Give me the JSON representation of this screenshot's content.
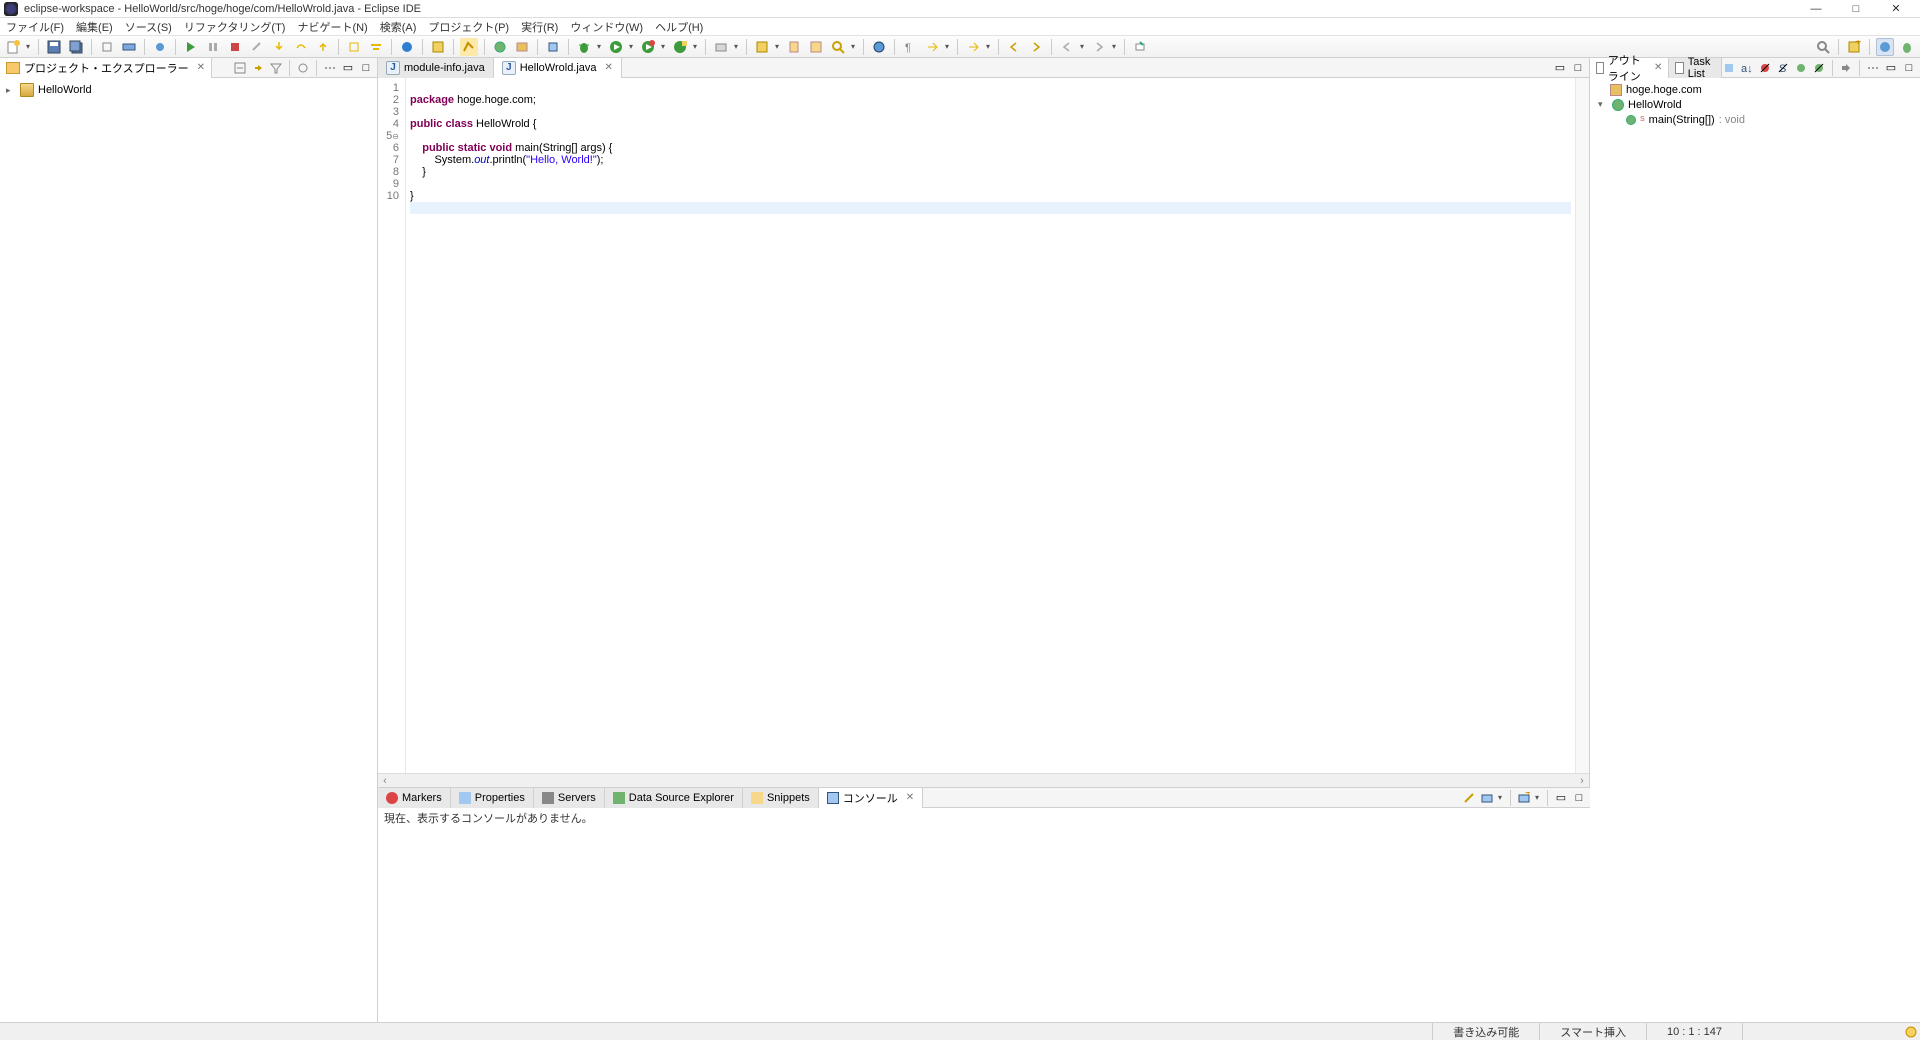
{
  "window": {
    "title": "eclipse-workspace - HelloWorld/src/hoge/hoge/com/HelloWrold.java - Eclipse IDE"
  },
  "menu": {
    "file": "ファイル(F)",
    "edit": "編集(E)",
    "source": "ソース(S)",
    "refactor": "リファクタリング(T)",
    "navigate": "ナビゲート(N)",
    "search": "検索(A)",
    "project": "プロジェクト(P)",
    "run": "実行(R)",
    "window": "ウィンドウ(W)",
    "help": "ヘルプ(H)"
  },
  "project_explorer": {
    "title": "プロジェクト・エクスプローラー",
    "items": [
      {
        "label": "HelloWorld"
      }
    ]
  },
  "editor": {
    "tabs": [
      {
        "label": "module-info.java",
        "active": false
      },
      {
        "label": "HelloWrold.java",
        "active": true
      }
    ],
    "lines": {
      "1": "package hoge.hoge.com;",
      "2": "",
      "3": "public class HelloWrold {",
      "4": "",
      "5": "    public static void main(String[] args) {",
      "6": "        System.out.println(\"Hello, World!\");",
      "7": "    }",
      "8": "",
      "9": "}",
      "10": ""
    }
  },
  "outline": {
    "title": "アウトライン",
    "tasklist": "Task List",
    "pkg": "hoge.hoge.com",
    "cls": "HelloWrold",
    "method": "main(String[])",
    "rettype": ": void"
  },
  "bottom": {
    "tabs": {
      "markers": "Markers",
      "properties": "Properties",
      "servers": "Servers",
      "dse": "Data Source Explorer",
      "snippets": "Snippets",
      "console": "コンソール"
    },
    "console_msg": "現在、表示するコンソールがありません。"
  },
  "status": {
    "writable": "書き込み可能",
    "insert": "スマート挿入",
    "pos": "10 : 1 : 147"
  }
}
